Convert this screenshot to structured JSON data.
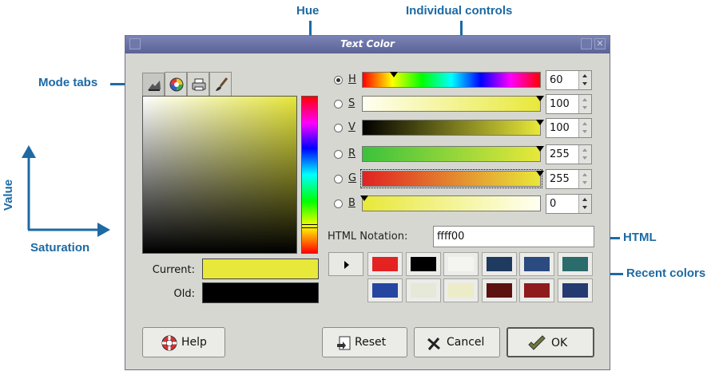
{
  "callouts": {
    "hue": "Hue",
    "individual_controls": "Individual controls",
    "mode_tabs": "Mode tabs",
    "value": "Value",
    "saturation": "Saturation",
    "html": "HTML",
    "recent_colors": "Recent colors"
  },
  "dialog": {
    "title": "Text Color",
    "current_label": "Current:",
    "old_label": "Old:",
    "current_color": "#e8e83a",
    "old_color": "#000000"
  },
  "mode_tabs": [
    {
      "icon": "scale-painter-icon"
    },
    {
      "icon": "color-wheel-icon"
    },
    {
      "icon": "printer-cmyk-icon"
    },
    {
      "icon": "watercolor-brush-icon"
    }
  ],
  "controls": [
    {
      "label": "H",
      "value": "60",
      "selected": true,
      "level": 0.17
    },
    {
      "label": "S",
      "value": "100",
      "selected": false,
      "level": 1.0
    },
    {
      "label": "V",
      "value": "100",
      "selected": false,
      "level": 1.0
    },
    {
      "label": "R",
      "value": "255",
      "selected": false,
      "level": 1.0
    },
    {
      "label": "G",
      "value": "255",
      "selected": false,
      "level": 1.0
    },
    {
      "label": "B",
      "value": "0",
      "selected": false,
      "level": 0.0
    }
  ],
  "html_notation": {
    "label": "HTML Notation:",
    "value": "ffff00"
  },
  "recent_colors": [
    "#e52222",
    "#000000",
    "#f4f4f0",
    "#1e3a5f",
    "#2a4a80",
    "#2a6b6b",
    "#2545a0",
    "#e6e8d8",
    "#ececc8",
    "#5c1010",
    "#8e1c1c",
    "#243a70"
  ],
  "buttons": {
    "help": "Help",
    "reset": "Reset",
    "cancel": "Cancel",
    "ok": "OK"
  }
}
